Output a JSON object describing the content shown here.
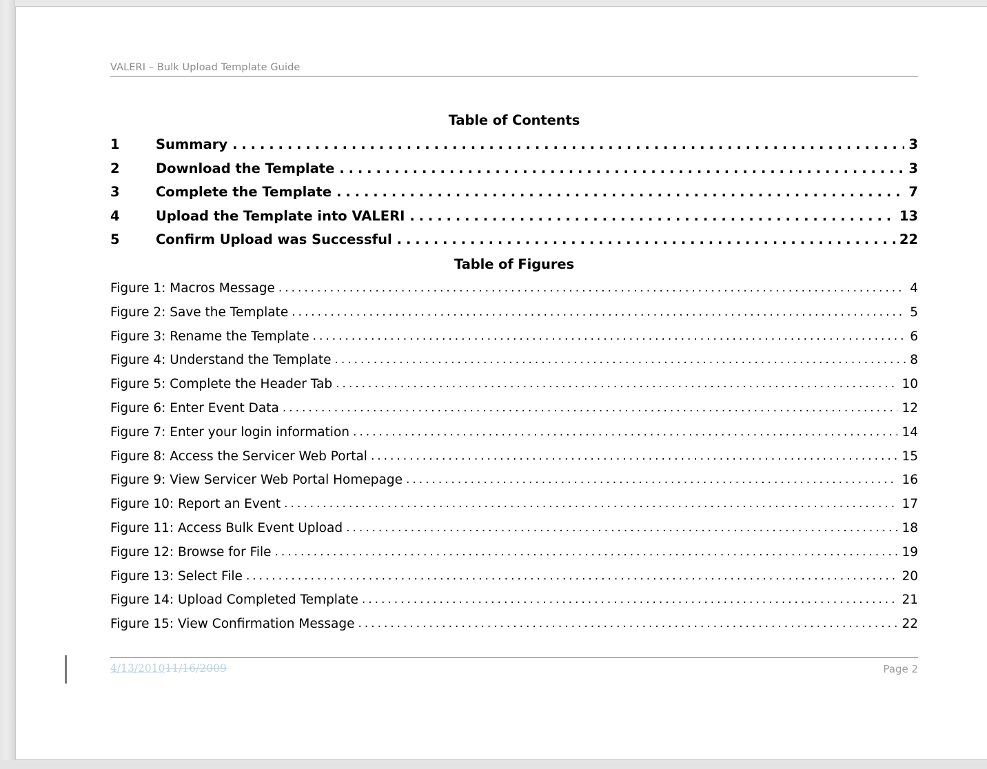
{
  "document": {
    "header_text": "VALERI – Bulk Upload Template Guide",
    "toc_heading": "Table of Contents",
    "tof_heading": "Table of Figures"
  },
  "toc": {
    "entries": [
      {
        "num": "1",
        "label": "Summary",
        "page": "3"
      },
      {
        "num": "2",
        "label": "Download the Template",
        "page": "3"
      },
      {
        "num": "3",
        "label": "Complete the Template",
        "page": "7"
      },
      {
        "num": "4",
        "label": "Upload the Template into VALERI",
        "page": "13"
      },
      {
        "num": "5",
        "label": "Confirm Upload was Successful",
        "page": "22"
      }
    ]
  },
  "figures": {
    "entries": [
      {
        "label": "Figure 1: Macros Message",
        "page": "4"
      },
      {
        "label": "Figure 2: Save the Template",
        "page": "5"
      },
      {
        "label": "Figure 3: Rename the Template",
        "page": "6"
      },
      {
        "label": "Figure 4: Understand the Template",
        "page": "8"
      },
      {
        "label": "Figure 5: Complete the Header Tab",
        "page": "10"
      },
      {
        "label": "Figure 6: Enter Event Data",
        "page": "12"
      },
      {
        "label": "Figure 7: Enter your login information",
        "page": "14"
      },
      {
        "label": "Figure 8: Access the Servicer Web Portal",
        "page": "15"
      },
      {
        "label": "Figure 9: View Servicer Web Portal Homepage",
        "page": "16"
      },
      {
        "label": "Figure 10: Report an Event",
        "page": "17"
      },
      {
        "label": "Figure 11: Access Bulk Event Upload",
        "page": "18"
      },
      {
        "label": "Figure 12: Browse for File",
        "page": "19"
      },
      {
        "label": "Figure 13: Select File",
        "page": "20"
      },
      {
        "label": "Figure 14: Upload Completed Template",
        "page": "21"
      },
      {
        "label": "Figure 15: View Confirmation Message",
        "page": "22"
      }
    ]
  },
  "footer": {
    "date_inserted": "4/13/2010",
    "date_deleted": "11/16/2009",
    "page_label": "Page 2"
  },
  "colors": {
    "page_background": "#ffffff",
    "viewer_background": "#e8e8e8",
    "header_text": "#8a8a8a",
    "rule": "#7d7d7d",
    "body_text": "#000000",
    "tracked_change": "#bcd2e8",
    "footer_page_text": "#9b9b9b",
    "change_bar": "#7a7a7a"
  }
}
